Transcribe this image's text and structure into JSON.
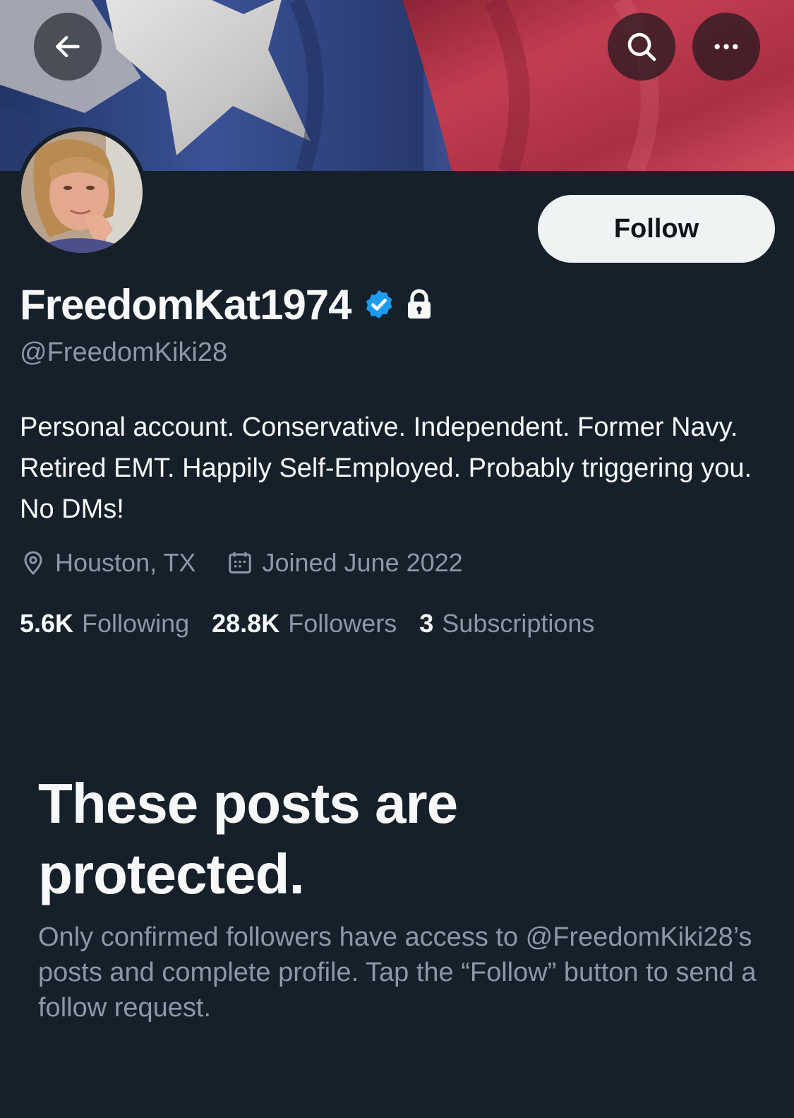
{
  "header": {
    "back_icon": "arrow-left-icon",
    "search_icon": "search-icon",
    "more_icon": "more-horizontal-icon"
  },
  "profile": {
    "display_name": "FreedomKat1974",
    "verified_icon": "verified-badge-icon",
    "protected_icon": "lock-icon",
    "handle": "@FreedomKiki28",
    "bio": "Personal account. Conservative. Independent. Former Navy. Retired EMT. Happily Self-Employed. Probably triggering you. No DMs!",
    "location": "Houston, TX",
    "joined": "Joined June 2022",
    "follow_label": "Follow"
  },
  "stats": {
    "following_count": "5.6K",
    "following_label": "Following",
    "followers_count": "28.8K",
    "followers_label": "Followers",
    "subscriptions_count": "3",
    "subscriptions_label": "Subscriptions"
  },
  "protected": {
    "title": "These posts are protected.",
    "body": "Only confirmed followers have access to @FreedomKiki28’s posts and complete profile. Tap the “Follow” button to send a follow request."
  },
  "colors": {
    "background": "#15202b",
    "text_primary": "#f7f9f9",
    "text_secondary": "#8b98a5",
    "verified": "#1d9bf0",
    "follow_button_bg": "#eff3f4"
  }
}
